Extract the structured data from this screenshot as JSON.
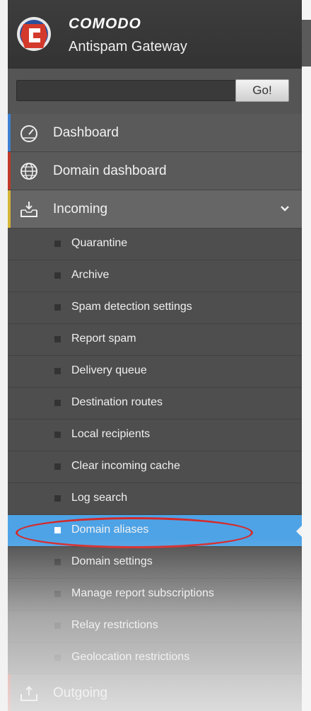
{
  "header": {
    "brand": "COMODO",
    "product": "Antispam Gateway"
  },
  "search": {
    "value": "",
    "go_label": "Go!"
  },
  "menu": {
    "dashboard": "Dashboard",
    "domain_dashboard": "Domain dashboard",
    "incoming": "Incoming",
    "outgoing": "Outgoing"
  },
  "incoming_items": [
    "Quarantine",
    "Archive",
    "Spam detection settings",
    "Report spam",
    "Delivery queue",
    "Destination routes",
    "Local recipients",
    "Clear incoming cache",
    "Log search",
    "Domain aliases",
    "Domain settings",
    "Manage report subscriptions",
    "Relay restrictions",
    "Geolocation restrictions"
  ],
  "colors": {
    "active": "#4ea3e6",
    "dashboard_accent": "#3d7fd0",
    "domain_dashboard_accent": "#c0392b",
    "incoming_accent": "#d4b437",
    "highlight_ring": "#d42a2a"
  },
  "icons": {
    "logo": "comodo-logo-icon",
    "dashboard": "speedometer-icon",
    "domain_dashboard": "globe-icon",
    "incoming": "inbox-in-icon",
    "outgoing": "inbox-out-icon",
    "expand": "chevron-down-icon"
  }
}
